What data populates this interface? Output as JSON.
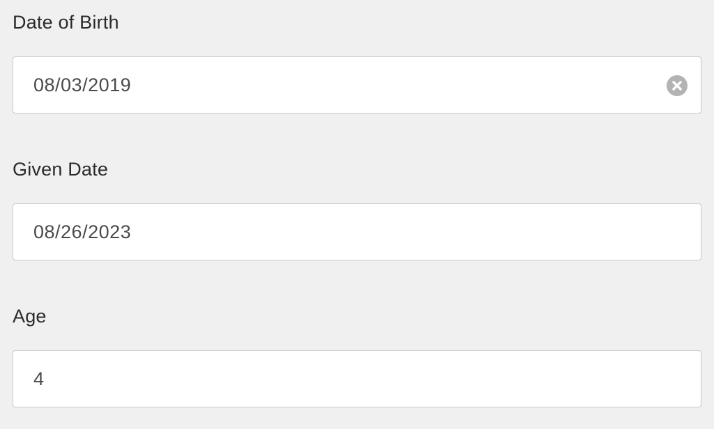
{
  "form": {
    "fields": [
      {
        "label": "Date of Birth",
        "value": "08/03/2019",
        "clearable": true,
        "clear_icon": "clear-circle-x-icon"
      },
      {
        "label": "Given Date",
        "value": "08/26/2023",
        "clearable": false
      },
      {
        "label": "Age",
        "value": "4",
        "clearable": false
      }
    ]
  },
  "colors": {
    "background": "#f0f0f0",
    "input_background": "#ffffff",
    "input_border": "#c9c9c9",
    "label_text": "#2a2a2a",
    "value_text": "#4a4a4a",
    "clear_icon": "#b3b3b3"
  }
}
